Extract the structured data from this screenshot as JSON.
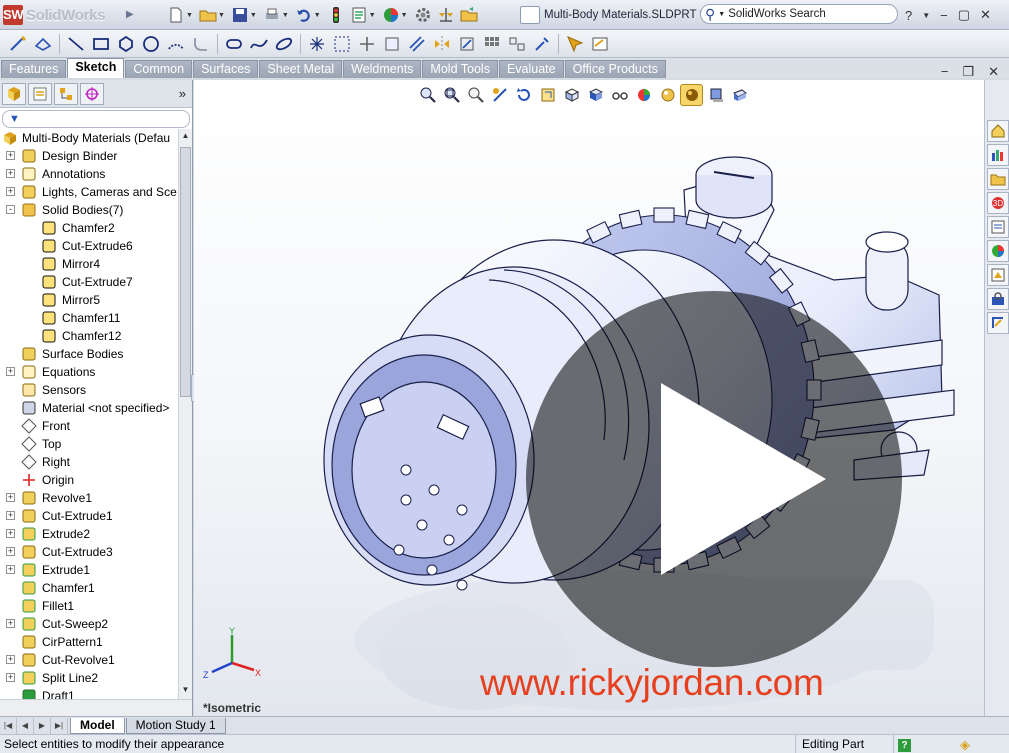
{
  "app": {
    "name": "SolidWorks",
    "logo_mark": "SW"
  },
  "title_bar": {
    "document": "Multi-Body Materials.SLDPRT *",
    "search_placeholder": "SolidWorks Search",
    "help": "?"
  },
  "tabs": [
    {
      "label": "Features",
      "active": false
    },
    {
      "label": "Sketch",
      "active": true
    },
    {
      "label": "Common",
      "active": false
    },
    {
      "label": "Surfaces",
      "active": false
    },
    {
      "label": "Sheet Metal",
      "active": false
    },
    {
      "label": "Weldments",
      "active": false
    },
    {
      "label": "Mold Tools",
      "active": false
    },
    {
      "label": "Evaluate",
      "active": false
    },
    {
      "label": "Office Products",
      "active": false
    }
  ],
  "tree": {
    "root": "Multi-Body Materials  (Defau",
    "items": [
      {
        "label": "Design Binder",
        "icon": "binder-icon",
        "expander": "+",
        "level": 0
      },
      {
        "label": "Annotations",
        "icon": "annotations-icon",
        "expander": "+",
        "level": 0
      },
      {
        "label": "Lights, Cameras and Scen",
        "icon": "lights-icon",
        "expander": "+",
        "level": 0
      },
      {
        "label": "Solid Bodies(7)",
        "icon": "folder-icon",
        "expander": "-",
        "level": 0
      },
      {
        "label": "Chamfer2",
        "icon": "solid-body-icon",
        "expander": "",
        "level": 1
      },
      {
        "label": "Cut-Extrude6",
        "icon": "solid-body-icon",
        "expander": "",
        "level": 1
      },
      {
        "label": "Mirror4",
        "icon": "solid-body-icon",
        "expander": "",
        "level": 1
      },
      {
        "label": "Cut-Extrude7",
        "icon": "solid-body-icon",
        "expander": "",
        "level": 1
      },
      {
        "label": "Mirror5",
        "icon": "solid-body-icon",
        "expander": "",
        "level": 1
      },
      {
        "label": "Chamfer11",
        "icon": "solid-body-icon",
        "expander": "",
        "level": 1
      },
      {
        "label": "Chamfer12",
        "icon": "solid-body-icon",
        "expander": "",
        "level": 1
      },
      {
        "label": "Surface Bodies",
        "icon": "surface-bodies-icon",
        "expander": "",
        "level": 0
      },
      {
        "label": "Equations",
        "icon": "equations-icon",
        "expander": "+",
        "level": 0
      },
      {
        "label": "Sensors",
        "icon": "sensors-icon",
        "expander": "",
        "level": 0
      },
      {
        "label": "Material <not specified>",
        "icon": "material-icon",
        "expander": "",
        "level": 0
      },
      {
        "label": "Front",
        "icon": "plane-icon",
        "expander": "",
        "level": 0
      },
      {
        "label": "Top",
        "icon": "plane-icon",
        "expander": "",
        "level": 0
      },
      {
        "label": "Right",
        "icon": "plane-icon",
        "expander": "",
        "level": 0
      },
      {
        "label": "Origin",
        "icon": "origin-icon",
        "expander": "",
        "level": 0
      },
      {
        "label": "Revolve1",
        "icon": "revolve-icon",
        "expander": "+",
        "level": 0
      },
      {
        "label": "Cut-Extrude1",
        "icon": "cut-extrude-icon",
        "expander": "+",
        "level": 0
      },
      {
        "label": "Extrude2",
        "icon": "extrude-icon",
        "expander": "+",
        "level": 0
      },
      {
        "label": "Cut-Extrude3",
        "icon": "cut-extrude-icon",
        "expander": "+",
        "level": 0
      },
      {
        "label": "Extrude1",
        "icon": "extrude-icon",
        "expander": "+",
        "level": 0
      },
      {
        "label": "Chamfer1",
        "icon": "chamfer-icon",
        "expander": "",
        "level": 0
      },
      {
        "label": "Fillet1",
        "icon": "fillet-icon",
        "expander": "",
        "level": 0
      },
      {
        "label": "Cut-Sweep2",
        "icon": "cut-sweep-icon",
        "expander": "+",
        "level": 0
      },
      {
        "label": "CirPattern1",
        "icon": "pattern-icon",
        "expander": "",
        "level": 0
      },
      {
        "label": "Cut-Revolve1",
        "icon": "cut-revolve-icon",
        "expander": "+",
        "level": 0
      },
      {
        "label": "Split Line2",
        "icon": "split-line-icon",
        "expander": "+",
        "level": 0
      },
      {
        "label": "Draft1",
        "icon": "draft-icon",
        "expander": "",
        "level": 0
      }
    ]
  },
  "viewport": {
    "view_label": "*Isometric",
    "watermark": "www.rickyjordan.com",
    "triad": {
      "x": "X",
      "y": "Y",
      "z": "Z"
    }
  },
  "bottom_tabs": [
    {
      "label": "Model",
      "active": true
    },
    {
      "label": "Motion Study 1",
      "active": false
    }
  ],
  "status": {
    "message": "Select entities to modify their appearance",
    "mode": "Editing Part",
    "help_badge": "?"
  },
  "colors": {
    "accent": "#e7401f",
    "tab_active": "#ffffff",
    "tab_inactive": "#a5afbe",
    "part": "#e8ecfb"
  }
}
